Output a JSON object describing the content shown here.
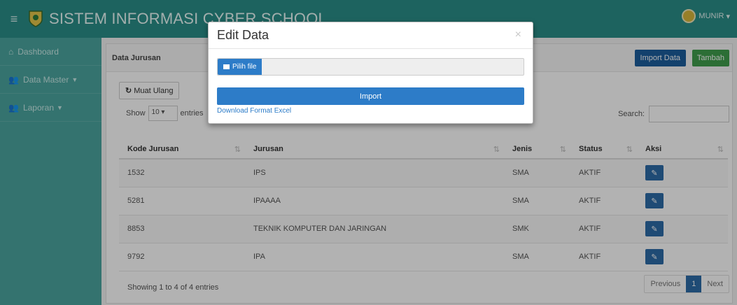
{
  "header": {
    "title": "SISTEM INFORMASI CYBER SCHOOL",
    "user": "MUNIR",
    "user_caret": "▾",
    "menu_icon": "hamburger-icon"
  },
  "sidebar": {
    "items": [
      {
        "label": "Dashboard",
        "icon": "home-icon"
      },
      {
        "label": "Data Master",
        "icon": "users-icon",
        "caret": "▼"
      },
      {
        "label": "Laporan",
        "icon": "users-icon",
        "caret": "▼"
      }
    ]
  },
  "panel": {
    "title": "Data Jurusan",
    "import_label": "Import Data",
    "tambah_label": "Tambah",
    "reload_label": "Muat Ulang",
    "show_prefix": "Show",
    "show_value": "10",
    "show_suffix": "entries",
    "search_label": "Search:"
  },
  "table": {
    "headers": [
      "Kode Jurusan",
      "Jurusan",
      "Jenis",
      "Status",
      "Aksi"
    ],
    "rows": [
      {
        "kode": "1532",
        "jurusan": "IPS",
        "jenis": "SMA",
        "status": "AKTIF"
      },
      {
        "kode": "5281",
        "jurusan": "IPAAAA",
        "jenis": "SMA",
        "status": "AKTIF"
      },
      {
        "kode": "8853",
        "jurusan": "TEKNIK KOMPUTER DAN JARINGAN",
        "jenis": "SMK",
        "status": "AKTIF"
      },
      {
        "kode": "9792",
        "jurusan": "IPA",
        "jenis": "SMA",
        "status": "AKTIF"
      }
    ],
    "footer": "Showing 1 to 4 of 4 entries",
    "pager": {
      "prev": "Previous",
      "current": "1",
      "next": "Next"
    }
  },
  "modal": {
    "title": "Edit Data",
    "close": "×",
    "file_button": "Pilih file",
    "import_button": "Import",
    "download_link": "Download Format Excel"
  },
  "colors": {
    "topbar": "#2a8f88",
    "sidebar": "#4ba59f",
    "primary": "#2d7cc8",
    "success": "#3f9e4c"
  }
}
